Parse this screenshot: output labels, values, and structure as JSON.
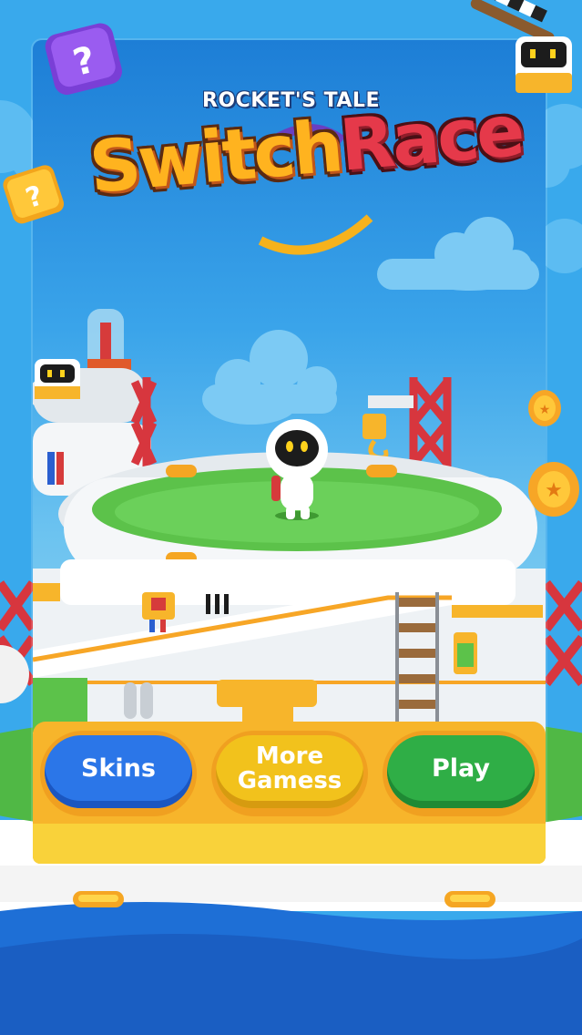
{
  "title": {
    "subtitle": "ROCKET'S TALE",
    "word1": "Switch",
    "word2": "Race"
  },
  "buttons": {
    "skins": "Skins",
    "more_games": "More Gamess",
    "play": "Play"
  },
  "colors": {
    "sky": "#38a8ec",
    "skins": "#2b76e8",
    "more_games": "#f2c21c",
    "play": "#2fae46",
    "panel": "#f7b52b",
    "grass": "#5cc24a",
    "ocean": "#1e6fd6"
  }
}
